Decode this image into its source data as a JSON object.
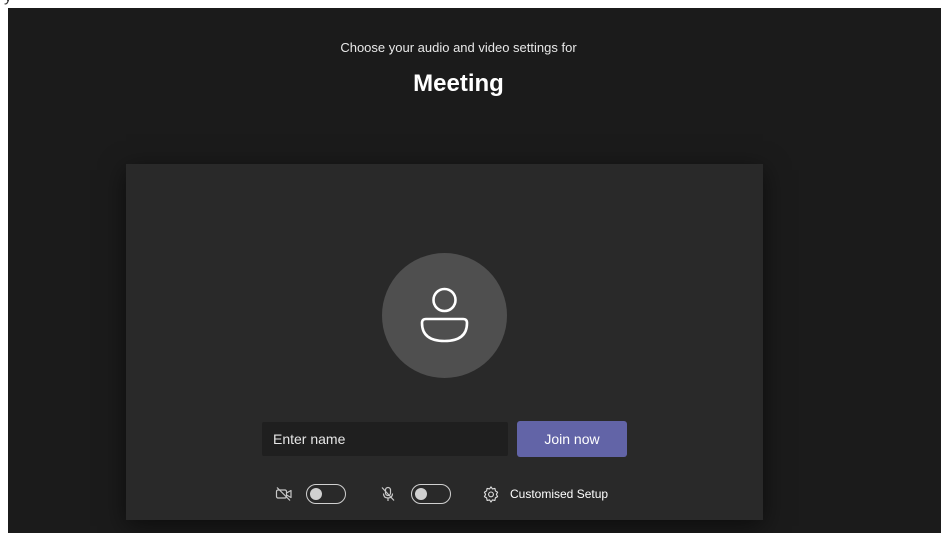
{
  "top_fragment": "y",
  "header": {
    "subtitle": "Choose your audio and video settings for",
    "title": "Meeting"
  },
  "prejoin": {
    "name_input": {
      "value": "",
      "placeholder": "Enter name"
    },
    "join_label": "Join now",
    "camera": {
      "icon": "camera-off-icon",
      "on": false
    },
    "microphone": {
      "icon": "mic-off-icon",
      "on": false
    },
    "setup": {
      "icon": "gear-icon",
      "label": "Customised Setup"
    }
  },
  "colors": {
    "background": "#1b1b1b",
    "panel": "#292929",
    "avatar": "#4f4f4f",
    "accent": "#6264a7",
    "input": "#1f1f1f"
  }
}
